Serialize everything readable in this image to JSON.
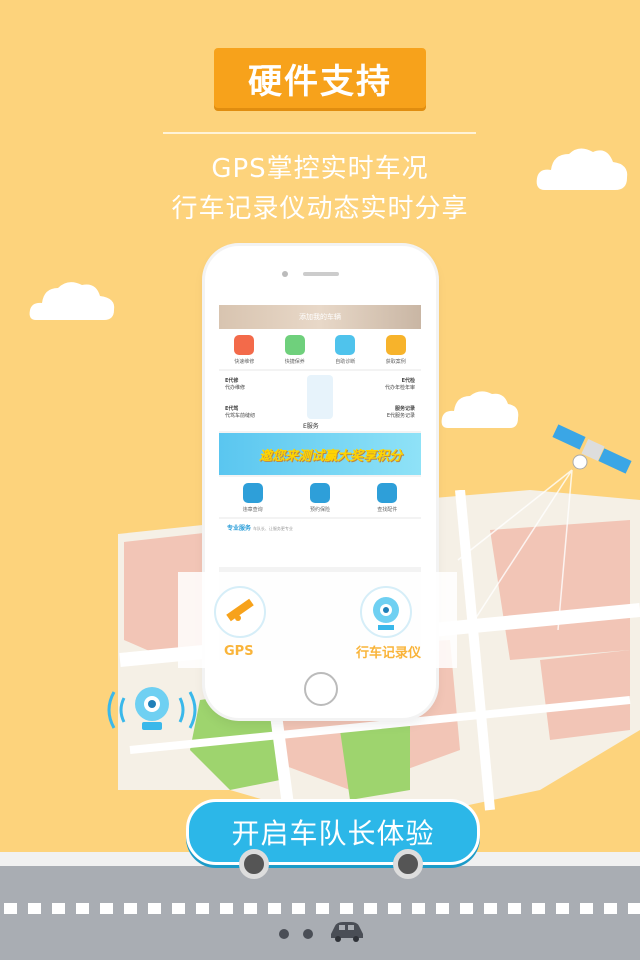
{
  "header": {
    "title": "硬件支持",
    "line1": "GPS掌控实时车况",
    "line2": "行车记录仪动态实时分享"
  },
  "phone_screen": {
    "banner_text": "添加我的车辆",
    "row1": [
      {
        "label": "快速维修",
        "color": "#f36a4a",
        "icon": "wrench-icon"
      },
      {
        "label": "快捷保养",
        "color": "#6fd07c",
        "icon": "bottle-icon"
      },
      {
        "label": "自助诊断",
        "color": "#4fc3ec",
        "icon": "stethoscope-icon"
      },
      {
        "label": "获取案例",
        "color": "#f7b32b",
        "icon": "document-icon"
      }
    ],
    "services": [
      {
        "title": "E代修",
        "desc": "代办维修"
      },
      {
        "title": "E代检",
        "desc": "代办年检年审"
      },
      {
        "title": "E代驾",
        "desc": "代驾车前缝纫"
      },
      {
        "title": "服务记录",
        "desc": "E代服务记录"
      }
    ],
    "center_label": "E服务",
    "ad_text": "邀您来测试赢大奖享积分",
    "row2": [
      {
        "label": "违章查询",
        "color": "#2e9fd9",
        "icon": "traffic-light-icon"
      },
      {
        "label": "预约保险",
        "color": "#2e9fd9",
        "icon": "car-shield-icon"
      },
      {
        "label": "查找配件",
        "color": "#2e9fd9",
        "icon": "steering-wheel-icon"
      }
    ],
    "section_title": "专业服务",
    "section_desc": "车队长、让服务更专业"
  },
  "popup": {
    "gps_label": "GPS",
    "recorder_label": "行车记录仪"
  },
  "cta": {
    "label": "开启车队长体验"
  },
  "pager": {
    "count": 2,
    "active": 0
  },
  "colors": {
    "background": "#fdd37c",
    "badge": "#f7a21b",
    "cta": "#2cb7e8",
    "road": "#a9adb3"
  }
}
